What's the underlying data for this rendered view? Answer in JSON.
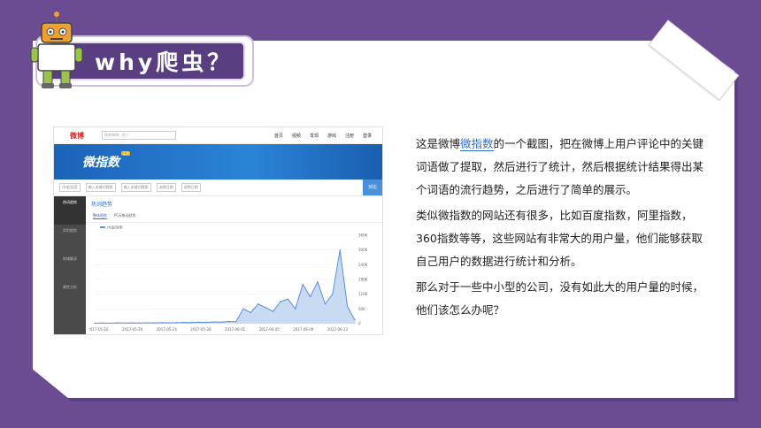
{
  "title": "why爬虫？",
  "paragraphs": {
    "p1_before": "这是微博",
    "p1_link": "微指数",
    "p1_after": "的一个截图，把在微博上用户评论中的关键词语做了提取，然后进行了统计，然后根据统计结果得出某个词语的流行趋势，之后进行了简单的展示。",
    "p2": "类似微指数的网站还有很多，比如百度指数，阿里指数，360指数等等，这些网站有非常大的用户量，他们能够获取自己用户的数据进行统计和分析。",
    "p3": "那么对于一些中小型的公司，没有如此大的用户量的时候，他们该怎么办呢？"
  },
  "screenshot": {
    "logo": "微博",
    "search_placeholder": "搜索微博、找人",
    "nav": [
      "首页",
      "视频",
      "发现",
      "游戏",
      "注册",
      "登录"
    ],
    "banner_title": "微指数",
    "banner_tag": "1.0",
    "filter_label": "rte起诉案",
    "filters": [
      "rte起诉案",
      "输入关键词搜索",
      "输入关键词搜索",
      "选择日期",
      "选择日期"
    ],
    "search_button": "对比",
    "side_items": [
      "热词趋势",
      "实时趋势",
      "地域解读",
      "属性分析"
    ],
    "section_title": "热词趋势",
    "tabs": [
      "整体趋势",
      "PC&移动趋势"
    ],
    "legend": "rte起诉案"
  },
  "chart_data": {
    "type": "area",
    "x": [
      "2017-05-16",
      "2017-05-20",
      "2017-05-24",
      "2017-05-28",
      "2017-06-01",
      "2017-06-05",
      "2017-06-09",
      "2017-06-13"
    ],
    "ylim": [
      0,
      360000
    ],
    "yticks": [
      "0",
      "60K",
      "120K",
      "180K",
      "240K",
      "300K",
      "360K"
    ],
    "series": [
      {
        "values": [
          2000,
          2500,
          2000,
          3000,
          2500,
          3000,
          2800,
          3200,
          3000,
          4000,
          3500,
          4200,
          5000,
          4500,
          6000,
          5500,
          7000,
          6500,
          9000,
          8000,
          60000,
          45000,
          80000,
          65000,
          50000,
          90000,
          100000,
          60000,
          160000,
          110000,
          170000,
          80000,
          120000,
          300000,
          70000,
          15000
        ]
      }
    ],
    "color": "#5b8fd9"
  }
}
